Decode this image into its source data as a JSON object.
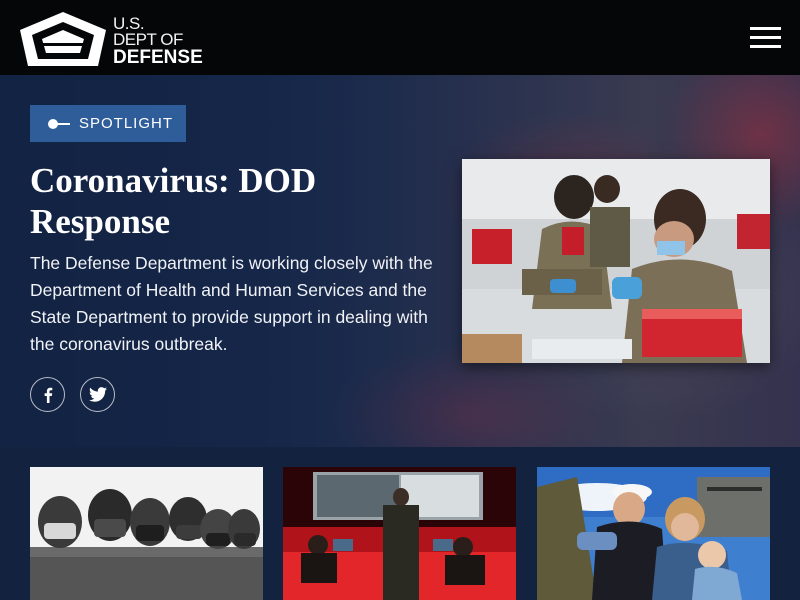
{
  "header": {
    "logo": {
      "line1": "U.S.",
      "line2": "DEPT OF",
      "line3": "DEFENSE"
    },
    "menu_icon": "hamburger-menu-icon"
  },
  "hero": {
    "badge": {
      "icon": "toggle-icon",
      "label": "SPOTLIGHT"
    },
    "title": "Coronavirus: DOD Response",
    "description": "The Defense Department is working closely with the Department of Health and Human Services and the State Department to provide support in dealing with the coronavirus outbreak.",
    "social": [
      {
        "name": "facebook",
        "icon": "facebook-icon"
      },
      {
        "name": "twitter",
        "icon": "twitter-icon"
      }
    ],
    "image": "photo-vaccine-preparation"
  },
  "cards": [
    {
      "image": "photo-masked-service-members"
    },
    {
      "image": "photo-operations-center"
    },
    {
      "image": "photo-sailor-homecoming"
    }
  ],
  "colors": {
    "header_bg": "#050607",
    "badge_bg": "#2e5d9a",
    "page_bg": "#12223f"
  }
}
